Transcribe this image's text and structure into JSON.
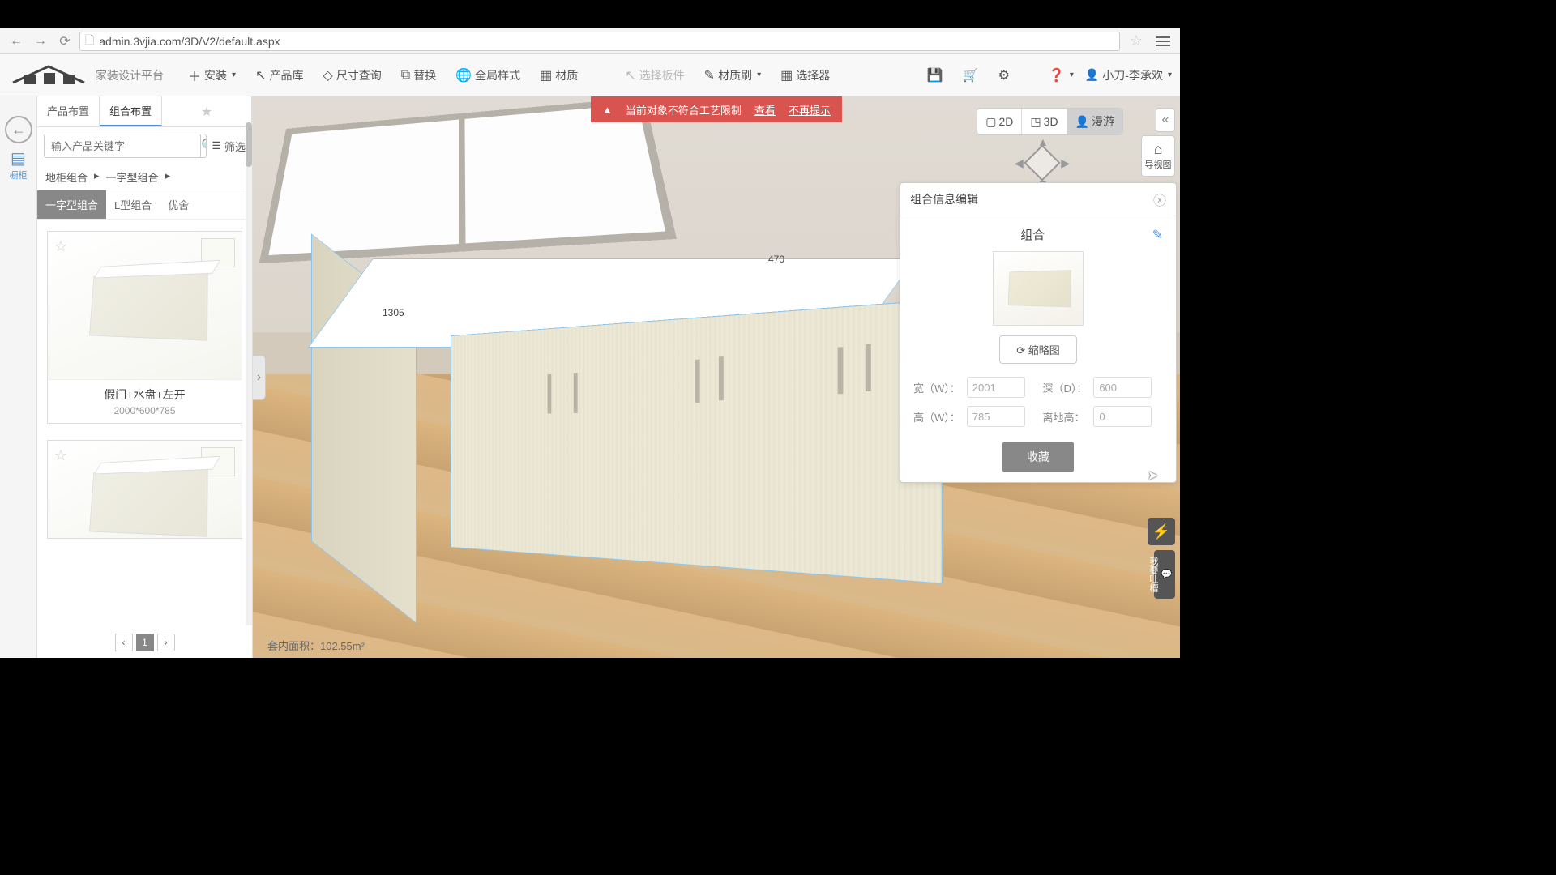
{
  "browser": {
    "url": "admin.3vjia.com/3D/V2/default.aspx"
  },
  "toolbar": {
    "logo_sub": "家装设计平台",
    "install": "安装",
    "product_lib": "产品库",
    "dimension": "尺寸查询",
    "replace": "替换",
    "global_style": "全局样式",
    "material": "材质",
    "select_panel": "选择板件",
    "material_brush": "材质刷",
    "selector": "选择器",
    "user": "小刀-李承欢"
  },
  "sidebar": {
    "tabs": {
      "layout": "产品布置",
      "combo": "组合布置"
    },
    "search_placeholder": "输入产品关键字",
    "filter": "筛选",
    "breadcrumbs": [
      "地柜组合",
      "一字型组合"
    ],
    "subtabs": [
      "一字型组合",
      "L型组合",
      "优舍"
    ],
    "cards": [
      {
        "title": "假门+水盘+左开",
        "dims": "2000*600*785"
      }
    ],
    "pager_current": "1"
  },
  "left_dock": {
    "cabinet": "橱柜"
  },
  "viewport": {
    "warning": "当前对象不符合工艺限制",
    "warn_view": "查看",
    "warn_dismiss": "不再提示",
    "dim1": "1305",
    "dim2": "470",
    "area": "套内面积：102.55m²",
    "view_2d": "2D",
    "view_3d": "3D",
    "view_roam": "漫游",
    "nav_map": "导视图"
  },
  "panel": {
    "title": "组合信息编辑",
    "subtitle": "组合",
    "thumb_btn": "缩略图",
    "width_label": "宽（W）：",
    "depth_label": "深（D）：",
    "height_label": "高（W）：",
    "ground_label": "离地高：",
    "width_val": "2001",
    "depth_val": "600",
    "height_val": "785",
    "ground_val": "0",
    "favorite": "收藏"
  },
  "edge": {
    "feedback": "我要吐槽"
  }
}
